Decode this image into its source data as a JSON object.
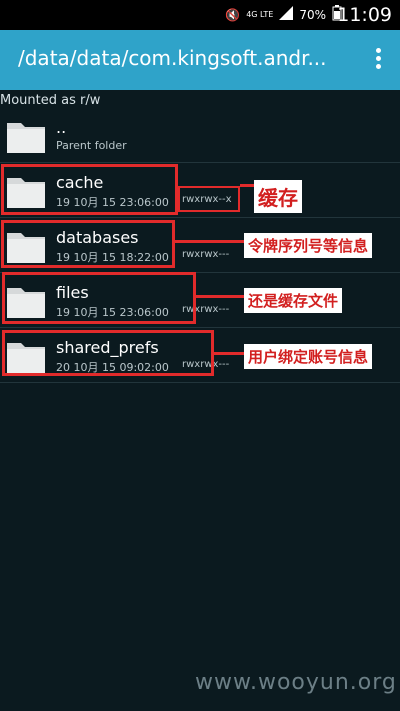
{
  "statusbar": {
    "network": "4G LTE",
    "battery": "70%",
    "time": "11:09"
  },
  "appbar": {
    "title": "/data/data/com.kingsoft.andr..."
  },
  "mount_status": "Mounted as r/w",
  "rows": [
    {
      "name": "..",
      "date": "Parent folder",
      "perm": ""
    },
    {
      "name": "cache",
      "date": "19 10月 15 23:06:00",
      "perm": "rwxrwx--x"
    },
    {
      "name": "databases",
      "date": "19 10月 15 18:22:00",
      "perm": "rwxrwx---"
    },
    {
      "name": "files",
      "date": "19 10月 15 23:06:00",
      "perm": "rwxrwx---"
    },
    {
      "name": "shared_prefs",
      "date": "20 10月 15 09:02:00",
      "perm": "rwxrwx---"
    }
  ],
  "annotations": [
    "缓存",
    "令牌序列号等信息",
    "还是缓存文件",
    "用户绑定账号信息"
  ],
  "watermark": "www.wooyun.org",
  "colors": {
    "appbar": "#2fa3c9",
    "background": "#0b1a1f",
    "annotation": "#e22b2b"
  }
}
